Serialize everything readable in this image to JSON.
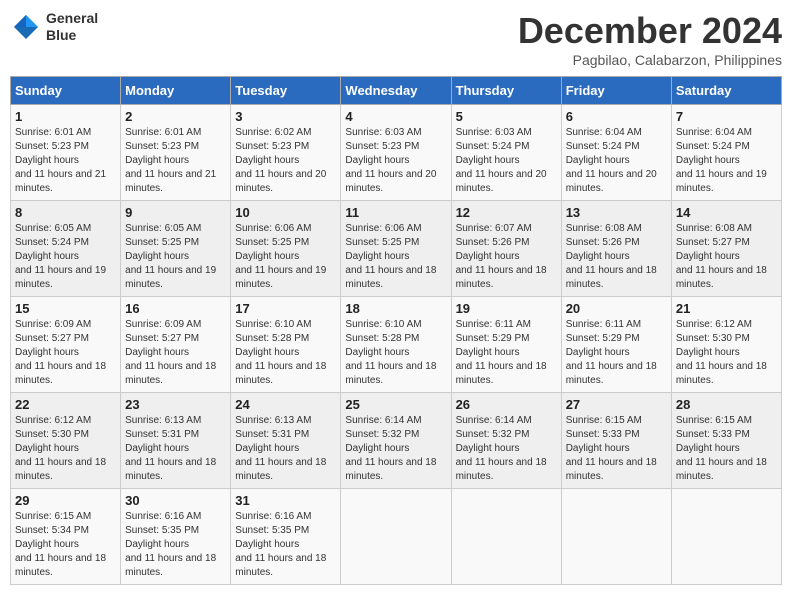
{
  "header": {
    "logo_line1": "General",
    "logo_line2": "Blue",
    "month": "December 2024",
    "location": "Pagbilao, Calabarzon, Philippines"
  },
  "weekdays": [
    "Sunday",
    "Monday",
    "Tuesday",
    "Wednesday",
    "Thursday",
    "Friday",
    "Saturday"
  ],
  "weeks": [
    [
      {
        "day": "1",
        "sunrise": "6:01 AM",
        "sunset": "5:23 PM",
        "daylight": "11 hours and 21 minutes."
      },
      {
        "day": "2",
        "sunrise": "6:01 AM",
        "sunset": "5:23 PM",
        "daylight": "11 hours and 21 minutes."
      },
      {
        "day": "3",
        "sunrise": "6:02 AM",
        "sunset": "5:23 PM",
        "daylight": "11 hours and 20 minutes."
      },
      {
        "day": "4",
        "sunrise": "6:03 AM",
        "sunset": "5:23 PM",
        "daylight": "11 hours and 20 minutes."
      },
      {
        "day": "5",
        "sunrise": "6:03 AM",
        "sunset": "5:24 PM",
        "daylight": "11 hours and 20 minutes."
      },
      {
        "day": "6",
        "sunrise": "6:04 AM",
        "sunset": "5:24 PM",
        "daylight": "11 hours and 20 minutes."
      },
      {
        "day": "7",
        "sunrise": "6:04 AM",
        "sunset": "5:24 PM",
        "daylight": "11 hours and 19 minutes."
      }
    ],
    [
      {
        "day": "8",
        "sunrise": "6:05 AM",
        "sunset": "5:24 PM",
        "daylight": "11 hours and 19 minutes."
      },
      {
        "day": "9",
        "sunrise": "6:05 AM",
        "sunset": "5:25 PM",
        "daylight": "11 hours and 19 minutes."
      },
      {
        "day": "10",
        "sunrise": "6:06 AM",
        "sunset": "5:25 PM",
        "daylight": "11 hours and 19 minutes."
      },
      {
        "day": "11",
        "sunrise": "6:06 AM",
        "sunset": "5:25 PM",
        "daylight": "11 hours and 18 minutes."
      },
      {
        "day": "12",
        "sunrise": "6:07 AM",
        "sunset": "5:26 PM",
        "daylight": "11 hours and 18 minutes."
      },
      {
        "day": "13",
        "sunrise": "6:08 AM",
        "sunset": "5:26 PM",
        "daylight": "11 hours and 18 minutes."
      },
      {
        "day": "14",
        "sunrise": "6:08 AM",
        "sunset": "5:27 PM",
        "daylight": "11 hours and 18 minutes."
      }
    ],
    [
      {
        "day": "15",
        "sunrise": "6:09 AM",
        "sunset": "5:27 PM",
        "daylight": "11 hours and 18 minutes."
      },
      {
        "day": "16",
        "sunrise": "6:09 AM",
        "sunset": "5:27 PM",
        "daylight": "11 hours and 18 minutes."
      },
      {
        "day": "17",
        "sunrise": "6:10 AM",
        "sunset": "5:28 PM",
        "daylight": "11 hours and 18 minutes."
      },
      {
        "day": "18",
        "sunrise": "6:10 AM",
        "sunset": "5:28 PM",
        "daylight": "11 hours and 18 minutes."
      },
      {
        "day": "19",
        "sunrise": "6:11 AM",
        "sunset": "5:29 PM",
        "daylight": "11 hours and 18 minutes."
      },
      {
        "day": "20",
        "sunrise": "6:11 AM",
        "sunset": "5:29 PM",
        "daylight": "11 hours and 18 minutes."
      },
      {
        "day": "21",
        "sunrise": "6:12 AM",
        "sunset": "5:30 PM",
        "daylight": "11 hours and 18 minutes."
      }
    ],
    [
      {
        "day": "22",
        "sunrise": "6:12 AM",
        "sunset": "5:30 PM",
        "daylight": "11 hours and 18 minutes."
      },
      {
        "day": "23",
        "sunrise": "6:13 AM",
        "sunset": "5:31 PM",
        "daylight": "11 hours and 18 minutes."
      },
      {
        "day": "24",
        "sunrise": "6:13 AM",
        "sunset": "5:31 PM",
        "daylight": "11 hours and 18 minutes."
      },
      {
        "day": "25",
        "sunrise": "6:14 AM",
        "sunset": "5:32 PM",
        "daylight": "11 hours and 18 minutes."
      },
      {
        "day": "26",
        "sunrise": "6:14 AM",
        "sunset": "5:32 PM",
        "daylight": "11 hours and 18 minutes."
      },
      {
        "day": "27",
        "sunrise": "6:15 AM",
        "sunset": "5:33 PM",
        "daylight": "11 hours and 18 minutes."
      },
      {
        "day": "28",
        "sunrise": "6:15 AM",
        "sunset": "5:33 PM",
        "daylight": "11 hours and 18 minutes."
      }
    ],
    [
      {
        "day": "29",
        "sunrise": "6:15 AM",
        "sunset": "5:34 PM",
        "daylight": "11 hours and 18 minutes."
      },
      {
        "day": "30",
        "sunrise": "6:16 AM",
        "sunset": "5:35 PM",
        "daylight": "11 hours and 18 minutes."
      },
      {
        "day": "31",
        "sunrise": "6:16 AM",
        "sunset": "5:35 PM",
        "daylight": "11 hours and 18 minutes."
      },
      null,
      null,
      null,
      null
    ]
  ]
}
